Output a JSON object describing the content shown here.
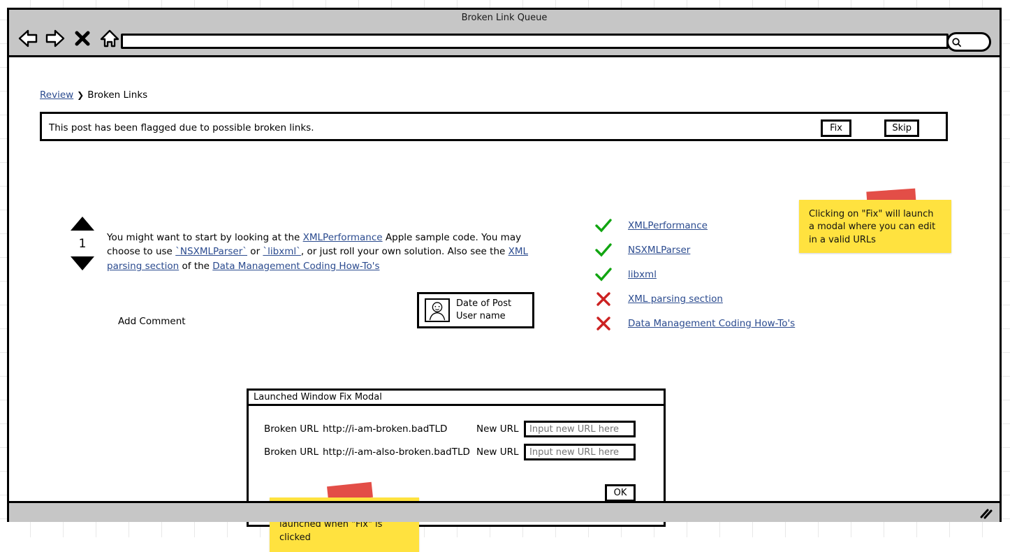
{
  "window": {
    "title": "Broken Link Queue",
    "url_value": "",
    "url_placeholder": "",
    "nav": [
      {
        "name": "back-icon",
        "label": "Back"
      },
      {
        "name": "forward-icon",
        "label": "Forward"
      },
      {
        "name": "stop-icon",
        "label": "Stop"
      },
      {
        "name": "home-icon",
        "label": "Home"
      }
    ],
    "search": {
      "icon": "search-icon",
      "value": "",
      "placeholder": ""
    }
  },
  "breadcrumb": {
    "root": "Review",
    "separator": "❯",
    "current": "Broken Links"
  },
  "flag_banner": {
    "message": "This post has been flagged due to possible broken links.",
    "fix_label": "Fix",
    "skip_label": "Skip"
  },
  "post": {
    "vote_count": "1",
    "upvote_icon": "triangle-up-icon",
    "downvote_icon": "triangle-down-icon",
    "text_parts": [
      {
        "t": "You might want to start by looking at the ",
        "link": false
      },
      {
        "t": "XMLPerformance",
        "link": true
      },
      {
        "t": " Apple sample code. You may choose to use ",
        "link": false
      },
      {
        "t": "`NSXMLParser`",
        "link": true
      },
      {
        "t": " or ",
        "link": false
      },
      {
        "t": "`libxml`",
        "link": true
      },
      {
        "t": ", or just roll your own solution. Also see the ",
        "link": false
      },
      {
        "t": "XML parsing section",
        "link": true
      },
      {
        "t": " of the ",
        "link": false
      },
      {
        "t": "Data Management Coding How-To's",
        "link": true
      }
    ],
    "add_comment_label": "Add Comment",
    "user_card": {
      "avatar_icon": "user-avatar-icon",
      "date_line": "Date of Post",
      "user_line": "User name"
    }
  },
  "link_status": {
    "items": [
      {
        "label": "XMLPerformance",
        "status": "ok",
        "icon": "check-icon"
      },
      {
        "label": "NSXMLParser",
        "status": "ok",
        "icon": "check-icon"
      },
      {
        "label": "libxml",
        "status": "ok",
        "icon": "check-icon"
      },
      {
        "label": "XML parsing section",
        "status": "broken",
        "icon": "x-icon"
      },
      {
        "label": "Data Management Coding How-To's",
        "status": "broken",
        "icon": "x-icon"
      }
    ],
    "ok_color": "#11a511",
    "broken_color": "#cc2222"
  },
  "modal": {
    "title": "Launched Window Fix Modal",
    "rows": [
      {
        "broken_label": "Broken URL",
        "broken_url": "http://i-am-broken.badTLD",
        "new_label": "New URL",
        "input_placeholder": "Input new URL here",
        "input_value": ""
      },
      {
        "broken_label": "Broken URL",
        "broken_url": "http://i-am-also-broken.badTLD",
        "new_label": "New URL",
        "input_placeholder": "Input new URL here",
        "input_value": ""
      }
    ],
    "ok_label": "OK"
  },
  "notes": [
    {
      "text": "Clicking on \"Fix\" will launch a modal where you can edit in a valid URLs"
    },
    {
      "text": "This is the modal that is launched when \"Fix\" is clicked"
    }
  ],
  "status_bar": {
    "resize_icon": "resize-grip-icon"
  },
  "colors": {
    "chrome": "#c6c6c6",
    "sticky": "#ffe23f",
    "tape": "#e03b33",
    "link": "#2b4b8f"
  }
}
